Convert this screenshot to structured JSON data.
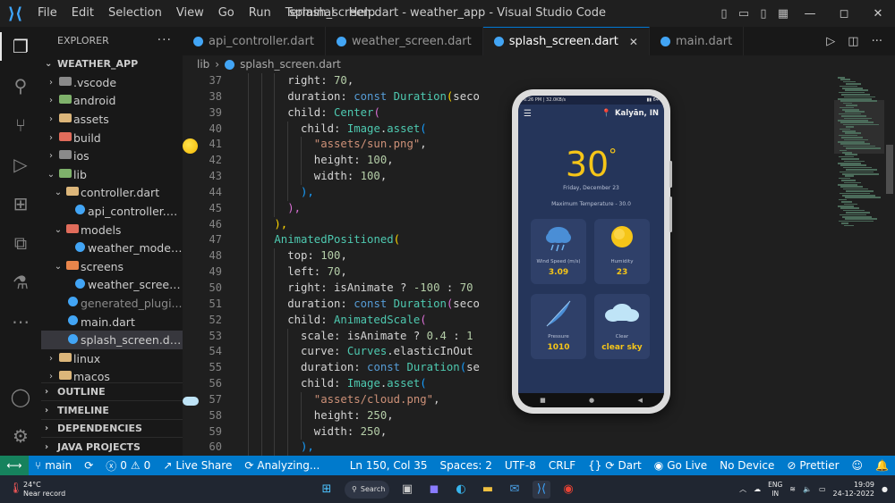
{
  "window": {
    "title": "splash_screen.dart - weather_app - Visual Studio Code",
    "menu": [
      "File",
      "Edit",
      "Selection",
      "View",
      "Go",
      "Run",
      "Terminal",
      "Help"
    ]
  },
  "sidebar": {
    "header": "EXPLORER",
    "root": "WEATHER_APP",
    "tree": [
      {
        "name": ".vscode",
        "type": "folder",
        "color": "grey",
        "depth": 1,
        "open": false
      },
      {
        "name": "android",
        "type": "folder",
        "color": "green",
        "depth": 1,
        "open": false
      },
      {
        "name": "assets",
        "type": "folder",
        "color": "yellow",
        "depth": 1,
        "open": false
      },
      {
        "name": "build",
        "type": "folder",
        "color": "red",
        "depth": 1,
        "open": false
      },
      {
        "name": "ios",
        "type": "folder",
        "color": "grey",
        "depth": 1,
        "open": false
      },
      {
        "name": "lib",
        "type": "folder",
        "color": "green",
        "depth": 1,
        "open": true
      },
      {
        "name": "controller.dart",
        "type": "folder",
        "color": "yellow",
        "depth": 2,
        "open": true
      },
      {
        "name": "api_controller.d...",
        "type": "dart",
        "depth": 3
      },
      {
        "name": "models",
        "type": "folder",
        "color": "red",
        "depth": 2,
        "open": true
      },
      {
        "name": "weather_model...",
        "type": "dart",
        "depth": 3
      },
      {
        "name": "screens",
        "type": "folder",
        "color": "orange",
        "depth": 2,
        "open": true
      },
      {
        "name": "weather_screen...",
        "type": "dart",
        "depth": 3
      },
      {
        "name": "generated_plugi...",
        "type": "dart",
        "depth": 2,
        "dim": true
      },
      {
        "name": "main.dart",
        "type": "dart",
        "depth": 2
      },
      {
        "name": "splash_screen.dart",
        "type": "dart",
        "depth": 2,
        "selected": true
      },
      {
        "name": "linux",
        "type": "folder",
        "color": "yellow",
        "depth": 1,
        "open": false
      },
      {
        "name": "macos",
        "type": "folder",
        "color": "yellow",
        "depth": 1,
        "open": false
      }
    ],
    "sections": [
      "OUTLINE",
      "TIMELINE",
      "DEPENDENCIES",
      "JAVA PROJECTS"
    ]
  },
  "tabs": [
    {
      "label": "api_controller.dart",
      "active": false
    },
    {
      "label": "weather_screen.dart",
      "active": false
    },
    {
      "label": "splash_screen.dart",
      "active": true
    },
    {
      "label": "main.dart",
      "active": false
    }
  ],
  "breadcrumb": {
    "folder": "lib",
    "file": "splash_screen.dart"
  },
  "editor": {
    "lines": [
      {
        "n": "37",
        "indent": 8,
        "tokens": [
          [
            "t-prop",
            "right: "
          ],
          [
            "t-num",
            "70"
          ],
          [
            "t-pun",
            ","
          ]
        ]
      },
      {
        "n": "38",
        "indent": 8,
        "tokens": [
          [
            "t-prop",
            "duration: "
          ],
          [
            "t-key",
            "const "
          ],
          [
            "t-cls",
            "Duration"
          ],
          [
            "t-br3",
            "("
          ],
          [
            "t-prop",
            "seco"
          ]
        ]
      },
      {
        "n": "39",
        "indent": 8,
        "tokens": [
          [
            "t-prop",
            "child: "
          ],
          [
            "t-cls",
            "Center"
          ],
          [
            "t-br1",
            "("
          ]
        ]
      },
      {
        "n": "40",
        "indent": 10,
        "tokens": [
          [
            "t-prop",
            "child: "
          ],
          [
            "t-cls",
            "Image"
          ],
          [
            "t-pun",
            "."
          ],
          [
            "t-cls",
            "asset"
          ],
          [
            "t-br2",
            "("
          ]
        ]
      },
      {
        "n": "41",
        "indent": 12,
        "tokens": [
          [
            "t-str",
            "\"assets/sun.png\""
          ],
          [
            "t-pun",
            ","
          ]
        ]
      },
      {
        "n": "42",
        "indent": 12,
        "tokens": [
          [
            "t-prop",
            "height: "
          ],
          [
            "t-num",
            "100"
          ],
          [
            "t-pun",
            ","
          ]
        ]
      },
      {
        "n": "43",
        "indent": 12,
        "tokens": [
          [
            "t-prop",
            "width: "
          ],
          [
            "t-num",
            "100"
          ],
          [
            "t-pun",
            ","
          ]
        ]
      },
      {
        "n": "44",
        "indent": 10,
        "tokens": [
          [
            "t-br2",
            "),"
          ]
        ]
      },
      {
        "n": "45",
        "indent": 8,
        "tokens": [
          [
            "t-br1",
            "),"
          ]
        ]
      },
      {
        "n": "46",
        "indent": 6,
        "tokens": [
          [
            "t-br3",
            "),"
          ]
        ]
      },
      {
        "n": "47",
        "indent": 6,
        "tokens": [
          [
            "t-cls",
            "AnimatedPositioned"
          ],
          [
            "t-br3",
            "("
          ]
        ]
      },
      {
        "n": "48",
        "indent": 8,
        "tokens": [
          [
            "t-prop",
            "top: "
          ],
          [
            "t-num",
            "100"
          ],
          [
            "t-pun",
            ","
          ]
        ]
      },
      {
        "n": "49",
        "indent": 8,
        "tokens": [
          [
            "t-prop",
            "left: "
          ],
          [
            "t-num",
            "70"
          ],
          [
            "t-pun",
            ","
          ]
        ]
      },
      {
        "n": "50",
        "indent": 8,
        "tokens": [
          [
            "t-prop",
            "right: isAnimate ? "
          ],
          [
            "t-num",
            "-100"
          ],
          [
            "t-prop",
            " : "
          ],
          [
            "t-num",
            "70"
          ]
        ]
      },
      {
        "n": "51",
        "indent": 8,
        "tokens": [
          [
            "t-prop",
            "duration: "
          ],
          [
            "t-key",
            "const "
          ],
          [
            "t-cls",
            "Duration"
          ],
          [
            "t-br1",
            "("
          ],
          [
            "t-prop",
            "seco"
          ]
        ]
      },
      {
        "n": "52",
        "indent": 8,
        "tokens": [
          [
            "t-prop",
            "child: "
          ],
          [
            "t-cls",
            "AnimatedScale"
          ],
          [
            "t-br1",
            "("
          ]
        ]
      },
      {
        "n": "53",
        "indent": 10,
        "tokens": [
          [
            "t-prop",
            "scale: isAnimate ? "
          ],
          [
            "t-num",
            "0.4"
          ],
          [
            "t-prop",
            " : "
          ],
          [
            "t-num",
            "1"
          ]
        ]
      },
      {
        "n": "54",
        "indent": 10,
        "tokens": [
          [
            "t-prop",
            "curve: "
          ],
          [
            "t-cls",
            "Curves"
          ],
          [
            "t-pun",
            "."
          ],
          [
            "t-prop",
            "elasticInOut"
          ]
        ]
      },
      {
        "n": "55",
        "indent": 10,
        "tokens": [
          [
            "t-prop",
            "duration: "
          ],
          [
            "t-key",
            "const "
          ],
          [
            "t-cls",
            "Duration"
          ],
          [
            "t-br2",
            "("
          ],
          [
            "t-prop",
            "se"
          ]
        ]
      },
      {
        "n": "56",
        "indent": 10,
        "tokens": [
          [
            "t-prop",
            "child: "
          ],
          [
            "t-cls",
            "Image"
          ],
          [
            "t-pun",
            "."
          ],
          [
            "t-cls",
            "asset"
          ],
          [
            "t-br2",
            "("
          ]
        ]
      },
      {
        "n": "57",
        "indent": 12,
        "tokens": [
          [
            "t-str",
            "\"assets/cloud.png\""
          ],
          [
            "t-pun",
            ","
          ]
        ]
      },
      {
        "n": "58",
        "indent": 12,
        "tokens": [
          [
            "t-prop",
            "height: "
          ],
          [
            "t-num",
            "250"
          ],
          [
            "t-pun",
            ","
          ]
        ]
      },
      {
        "n": "59",
        "indent": 12,
        "tokens": [
          [
            "t-prop",
            "width: "
          ],
          [
            "t-num",
            "250"
          ],
          [
            "t-pun",
            ","
          ]
        ]
      },
      {
        "n": "60",
        "indent": 10,
        "tokens": [
          [
            "t-br2",
            "),"
          ]
        ]
      }
    ]
  },
  "phone": {
    "status_time": "6:26 PM | 32.0KB/s",
    "status_right": "▮▮ 64",
    "location": "Kalyān, IN",
    "temp": "30",
    "degree": "°",
    "date": "Friday, December 23",
    "max_temp": "Maximum Temperature - 30.0",
    "cards": [
      {
        "label": "Wind Speed (m/s)",
        "value": "3.09",
        "icon": "cloud-rain-icon"
      },
      {
        "label": "Humidity",
        "value": "23",
        "icon": "sun-icon"
      },
      {
        "label": "Pressure",
        "value": "1010",
        "icon": "feather-icon"
      },
      {
        "label": "Clear",
        "value": "clear sky",
        "icon": "cloud-icon"
      }
    ]
  },
  "statusbar": {
    "branch": "main",
    "errors": "0",
    "warnings": "0",
    "live_share": "Live Share",
    "analyzing": "Analyzing...",
    "position": "Ln 150, Col 35",
    "spaces": "Spaces: 2",
    "encoding": "UTF-8",
    "eol": "CRLF",
    "language": "Dart",
    "go_live": "Go Live",
    "device": "No Device",
    "prettier": "Prettier"
  },
  "taskbar": {
    "temp": "24°C",
    "weather": "Near record",
    "search": "Search",
    "lang1": "ENG",
    "lang2": "IN",
    "time": "19:09",
    "date": "24-12-2022"
  }
}
